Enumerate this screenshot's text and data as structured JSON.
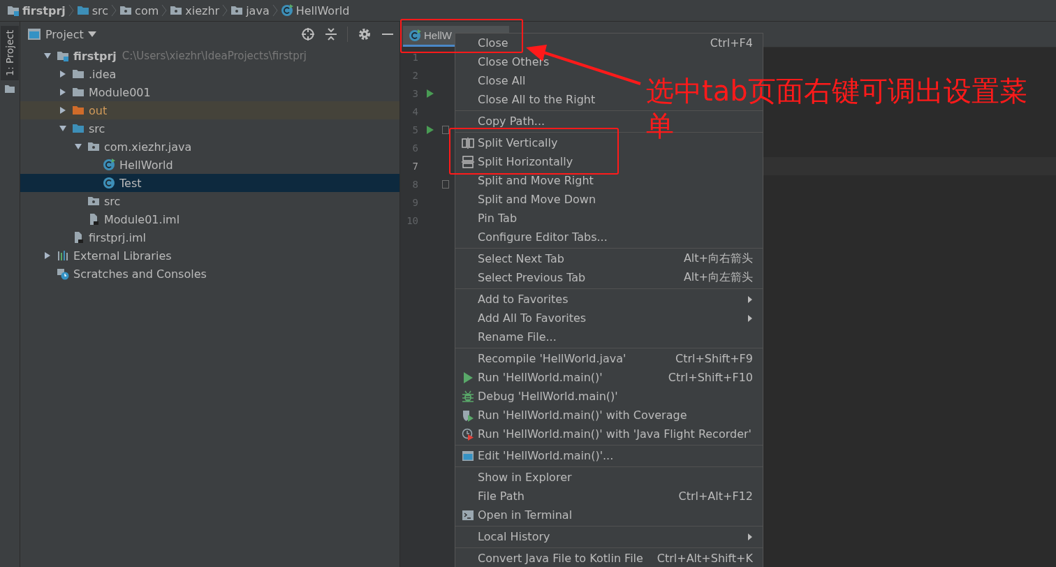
{
  "breadcrumbs": [
    {
      "label": "firstprj",
      "kind": "project"
    },
    {
      "label": "src",
      "kind": "source-folder"
    },
    {
      "label": "com",
      "kind": "package"
    },
    {
      "label": "xiezhr",
      "kind": "package"
    },
    {
      "label": "java",
      "kind": "package"
    },
    {
      "label": "HellWorld",
      "kind": "class-run"
    }
  ],
  "tool_strip": {
    "label": "1: Project"
  },
  "project_panel": {
    "title": "Project",
    "tree": [
      {
        "label": "firstprj",
        "path": "C:\\Users\\xiezhr\\IdeaProjects\\firstprj",
        "kind": "project",
        "expanded": true,
        "selected": false,
        "excluded": false,
        "children": [
          {
            "label": ".idea",
            "kind": "folder",
            "expanded": false,
            "selected": false,
            "excluded": false
          },
          {
            "label": "Module001",
            "kind": "folder",
            "expanded": false,
            "selected": false,
            "excluded": false
          },
          {
            "label": "out",
            "kind": "excluded-folder",
            "expanded": false,
            "selected": false,
            "excluded": true
          },
          {
            "label": "src",
            "kind": "source-folder",
            "expanded": true,
            "selected": false,
            "excluded": false,
            "children": [
              {
                "label": "com.xiezhr.java",
                "kind": "package",
                "expanded": true,
                "selected": false,
                "excluded": false,
                "children": [
                  {
                    "label": "HellWorld",
                    "kind": "class-run",
                    "selected": false,
                    "excluded": false
                  },
                  {
                    "label": "Test",
                    "kind": "class",
                    "selected": true,
                    "excluded": false
                  }
                ]
              },
              {
                "label": "src",
                "kind": "package",
                "selected": false,
                "excluded": false
              },
              {
                "label": "Module01.iml",
                "kind": "module-file",
                "selected": false,
                "excluded": false
              }
            ]
          },
          {
            "label": "firstprj.iml",
            "kind": "module-file",
            "selected": false,
            "excluded": false
          }
        ]
      },
      {
        "label": "External Libraries",
        "kind": "libraries",
        "expanded": false,
        "selected": false,
        "excluded": false
      },
      {
        "label": "Scratches and Consoles",
        "kind": "scratches",
        "selected": false,
        "excluded": false
      }
    ]
  },
  "editor": {
    "tabs": [
      {
        "label": "HellW",
        "kind": "class-run",
        "selected": true
      }
    ],
    "lines": [
      {
        "number": "1",
        "run": false,
        "fold": false,
        "current": false
      },
      {
        "number": "2",
        "run": false,
        "fold": false,
        "current": false
      },
      {
        "number": "3",
        "run": true,
        "fold": false,
        "current": false
      },
      {
        "number": "4",
        "run": false,
        "fold": false,
        "current": false
      },
      {
        "number": "5",
        "run": true,
        "fold": true,
        "current": false
      },
      {
        "number": "6",
        "run": false,
        "fold": false,
        "current": false
      },
      {
        "number": "7",
        "run": false,
        "fold": false,
        "current": true
      },
      {
        "number": "8",
        "run": false,
        "fold": true,
        "current": false
      },
      {
        "number": "9",
        "run": false,
        "fold": false,
        "current": false
      },
      {
        "number": "10",
        "run": false,
        "fold": false,
        "current": false
      }
    ]
  },
  "context_menu": {
    "groups": [
      [
        {
          "label": "Close",
          "shortcut": "Ctrl+F4",
          "kind": "action"
        },
        {
          "label": "Close Others",
          "kind": "action"
        },
        {
          "label": "Close All",
          "kind": "action"
        },
        {
          "label": "Close All to the Right",
          "kind": "action"
        }
      ],
      [
        {
          "label": "Copy Path...",
          "kind": "action"
        }
      ],
      [
        {
          "label": "Split Vertically",
          "kind": "split-vertical"
        },
        {
          "label": "Split Horizontally",
          "kind": "split-horizontal"
        },
        {
          "label": "Split and Move Right",
          "kind": "action"
        },
        {
          "label": "Split and Move Down",
          "kind": "action"
        },
        {
          "label": "Pin Tab",
          "kind": "action"
        },
        {
          "label": "Configure Editor Tabs...",
          "kind": "action"
        }
      ],
      [
        {
          "label": "Select Next Tab",
          "shortcut": "Alt+向右箭头",
          "kind": "action"
        },
        {
          "label": "Select Previous Tab",
          "shortcut": "Alt+向左箭头",
          "kind": "action"
        }
      ],
      [
        {
          "label": "Add to Favorites",
          "kind": "submenu"
        },
        {
          "label": "Add All To Favorites",
          "kind": "submenu"
        },
        {
          "label": "Rename File...",
          "kind": "action"
        }
      ],
      [
        {
          "label": "Recompile 'HellWorld.java'",
          "shortcut": "Ctrl+Shift+F9",
          "kind": "action"
        },
        {
          "label": "Run 'HellWorld.main()'",
          "shortcut": "Ctrl+Shift+F10",
          "kind": "run"
        },
        {
          "label": "Debug 'HellWorld.main()'",
          "kind": "debug"
        },
        {
          "label": "Run 'HellWorld.main()' with Coverage",
          "kind": "coverage"
        },
        {
          "label": "Run 'HellWorld.main()' with 'Java Flight Recorder'",
          "kind": "profiler"
        }
      ],
      [
        {
          "label": "Edit 'HellWorld.main()'...",
          "kind": "edit-config"
        }
      ],
      [
        {
          "label": "Show in Explorer",
          "kind": "action"
        },
        {
          "label": "File Path",
          "shortcut": "Ctrl+Alt+F12",
          "kind": "action"
        },
        {
          "label": "Open in Terminal",
          "kind": "terminal"
        }
      ],
      [
        {
          "label": "Local History",
          "kind": "submenu"
        }
      ],
      [
        {
          "label": "Convert Java File to Kotlin File",
          "shortcut": "Ctrl+Alt+Shift+K",
          "kind": "action"
        }
      ]
    ]
  },
  "annotation": {
    "text": "选中tab页面右键可调出设置菜单"
  }
}
